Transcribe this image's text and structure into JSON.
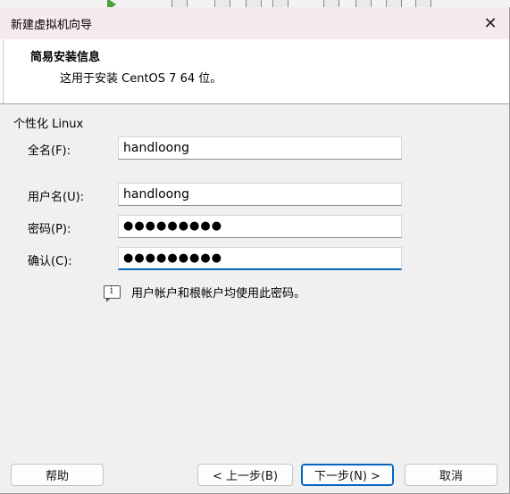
{
  "dialog": {
    "title": "新建虚拟机向导",
    "header_title": "简易安装信息",
    "header_subtitle": "这用于安装 CentOS 7 64 位。"
  },
  "section": {
    "label": "个性化 Linux"
  },
  "fields": {
    "fullname": {
      "label": "全名(F):",
      "value": "handloong"
    },
    "username": {
      "label": "用户名(U):",
      "value": "handloong"
    },
    "password": {
      "label": "密码(P):",
      "value": "●●●●●●●●●"
    },
    "confirm": {
      "label": "确认(C):",
      "value": "●●●●●●●●●"
    }
  },
  "hint": {
    "text": "用户帐户和根帐户均使用此密码。",
    "icon": "info-icon"
  },
  "buttons": {
    "help": "帮助",
    "back": "< 上一步(B)",
    "next": "下一步(N) >",
    "cancel": "取消"
  },
  "colors": {
    "titlebar_bg": "#f7eaee",
    "focus_accent": "#0067c0",
    "dialog_bg": "#f0f0f0"
  }
}
